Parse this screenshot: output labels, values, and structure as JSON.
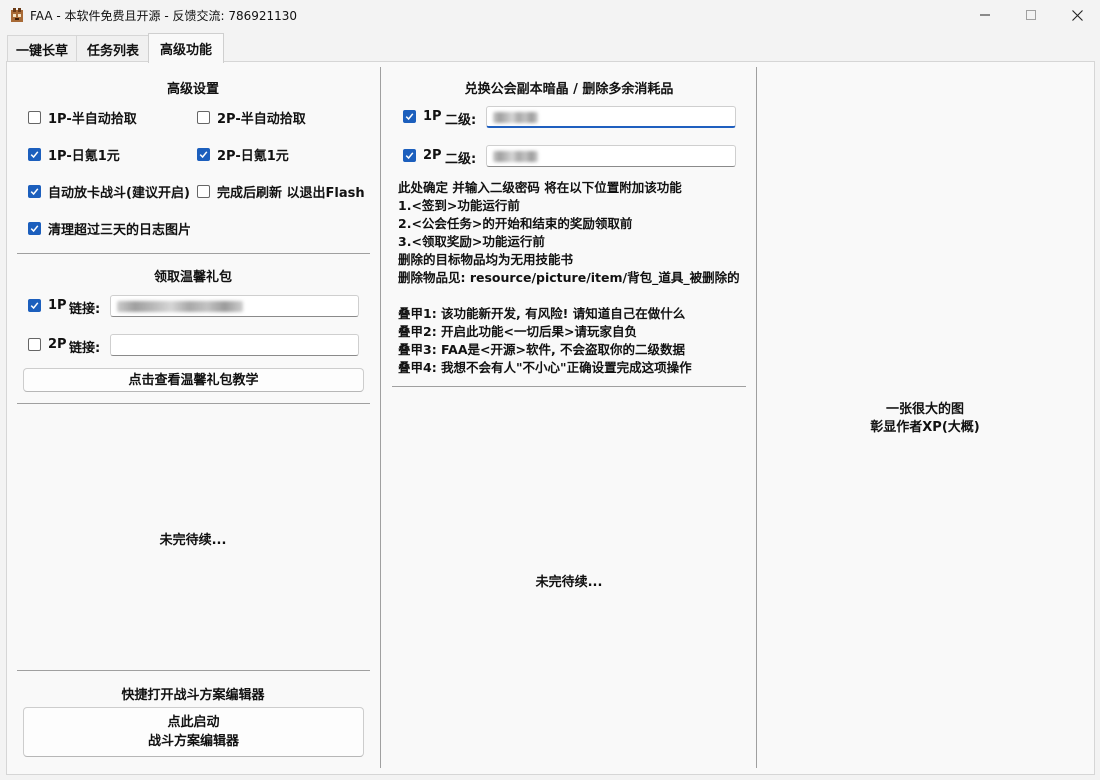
{
  "window": {
    "title": "FAA - 本软件免费且开源 - 反馈交流: 786921130",
    "icon": "faa-app-icon"
  },
  "tabs": [
    {
      "label": "一键长草",
      "active": false
    },
    {
      "label": "任务列表",
      "active": false
    },
    {
      "label": "高级功能",
      "active": true
    }
  ],
  "advanced": {
    "heading": "高级设置",
    "options": [
      {
        "label": "1P-半自动拾取",
        "checked": false
      },
      {
        "label": "2P-半自动拾取",
        "checked": false
      },
      {
        "label": "1P-日氪1元",
        "checked": true
      },
      {
        "label": "2P-日氪1元",
        "checked": true
      },
      {
        "label": "自动放卡战斗(建议开启)",
        "checked": true
      },
      {
        "label": "完成后刷新 以退出Flash",
        "checked": false
      },
      {
        "label": "清理超过三天的日志图片",
        "checked": true
      }
    ]
  },
  "gift": {
    "heading": "领取温馨礼包",
    "p1": {
      "label": "1P",
      "checked": true,
      "link_label": "链接:"
    },
    "p2": {
      "label": "2P",
      "checked": false,
      "link_label": "链接:"
    },
    "tutorial_button": "点击查看温馨礼包教学"
  },
  "left_placeholder": "未完待续...",
  "editor": {
    "heading": "快捷打开战斗方案编辑器",
    "button_line1": "点此启动",
    "button_line2": "战斗方案编辑器"
  },
  "exchange": {
    "heading": "兑换公会副本暗晶 / 删除多余消耗品",
    "p1": {
      "label": "1P",
      "checked": true,
      "pwd_label": "二级:"
    },
    "p2": {
      "label": "2P",
      "checked": true,
      "pwd_label": "二级:"
    },
    "info_lines": [
      "此处确定 并输入二级密码 将在以下位置附加该功能",
      "1.<签到>功能运行前",
      "2.<公会任务>的开始和结束的奖励领取前",
      "3.<领取奖励>功能运行前",
      "删除的目标物品均为无用技能书",
      "删除物品见: resource/picture/item/背包_道具_被删除的",
      "",
      "叠甲1: 该功能新开发, 有风险! 请知道自己在做什么",
      "叠甲2: 开启此功能<一切后果>请玩家自负",
      "叠甲3: FAA是<开源>软件, 不会盗取你的二级数据",
      "叠甲4: 我想不会有人\"不小心\"正确设置完成这项操作"
    ]
  },
  "middle_placeholder": "未完待续...",
  "right": {
    "line1": "一张很大的图",
    "line2": "彰显作者XP(大概)"
  },
  "colors": {
    "accent": "#1c5fbd",
    "window_bg": "#f3f3f3",
    "panel_bg": "#f9f9f9"
  }
}
